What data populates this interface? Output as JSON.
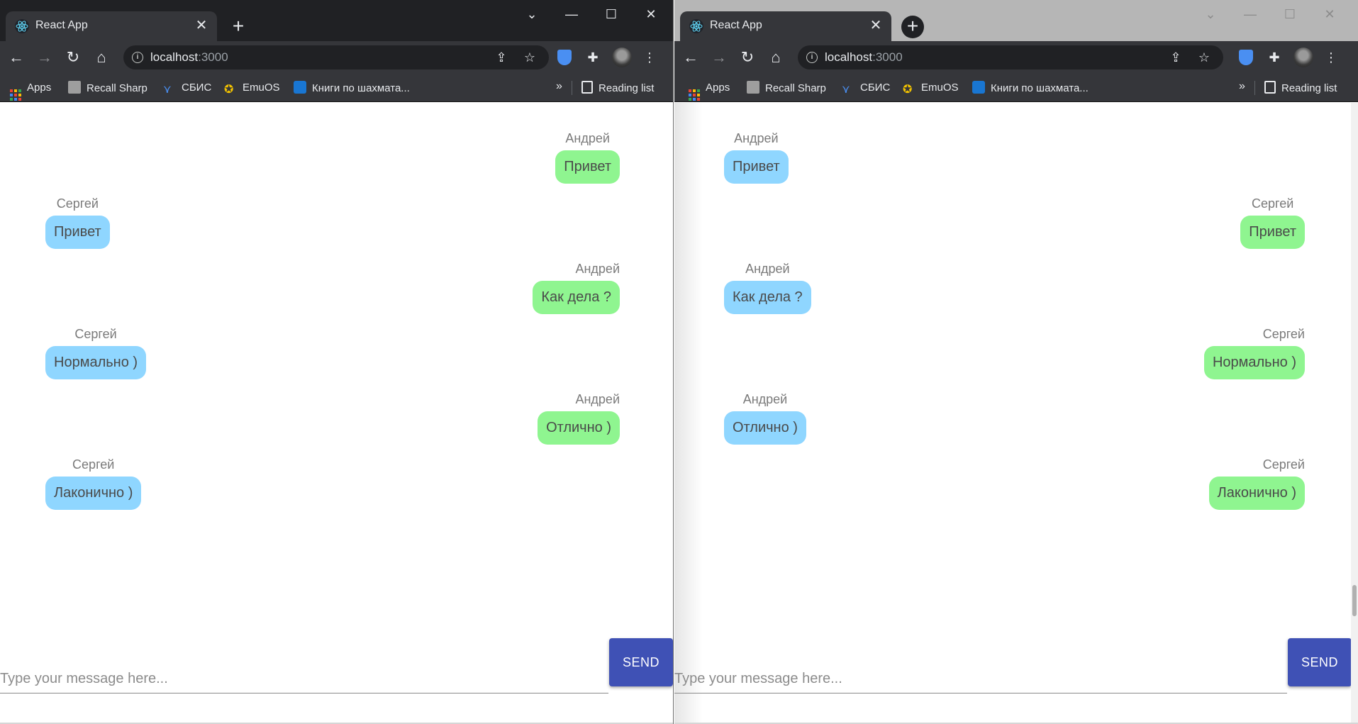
{
  "windows": [
    {
      "tab_title": "React App",
      "url_host": "localhost",
      "url_port": ":3000",
      "bookmarks": {
        "apps": "Apps",
        "recall_sharp": "Recall Sharp",
        "sbis": "СБИС",
        "emuos": "EmuOS",
        "chess_books": "Книги по шахмата...",
        "more": "»",
        "reading_list": "Reading list"
      },
      "messages": [
        {
          "sender": "Андрей",
          "text": "Привет",
          "side": "right",
          "color": "green"
        },
        {
          "sender": "Сергей",
          "text": "Привет",
          "side": "left",
          "color": "blue"
        },
        {
          "sender": "Андрей",
          "text": "Как дела ?",
          "side": "right",
          "color": "green"
        },
        {
          "sender": "Сергей",
          "text": "Нормально )",
          "side": "left",
          "color": "blue"
        },
        {
          "sender": "Андрей",
          "text": "Отлично )",
          "side": "right",
          "color": "green"
        },
        {
          "sender": "Сергей",
          "text": "Лаконично )",
          "side": "left",
          "color": "blue"
        }
      ],
      "input_placeholder": "Type your message here...",
      "send_label": "SEND"
    },
    {
      "tab_title": "React App",
      "url_host": "localhost",
      "url_port": ":3000",
      "bookmarks": {
        "apps": "Apps",
        "recall_sharp": "Recall Sharp",
        "sbis": "СБИС",
        "emuos": "EmuOS",
        "chess_books": "Книги по шахмата...",
        "more": "»",
        "reading_list": "Reading list"
      },
      "messages": [
        {
          "sender": "Андрей",
          "text": "Привет",
          "side": "left",
          "color": "blue"
        },
        {
          "sender": "Сергей",
          "text": "Привет",
          "side": "right",
          "color": "green"
        },
        {
          "sender": "Андрей",
          "text": "Как дела ?",
          "side": "left",
          "color": "blue"
        },
        {
          "sender": "Сергей",
          "text": "Нормально )",
          "side": "right",
          "color": "green"
        },
        {
          "sender": "Андрей",
          "text": "Отлично )",
          "side": "left",
          "color": "blue"
        },
        {
          "sender": "Сергей",
          "text": "Лаконично )",
          "side": "right",
          "color": "green"
        }
      ],
      "input_placeholder": "Type your message here...",
      "send_label": "SEND"
    }
  ],
  "colors": {
    "bubble_green": "#8ff590",
    "bubble_blue": "#8fd6ff",
    "send_button": "#3f51b5"
  }
}
